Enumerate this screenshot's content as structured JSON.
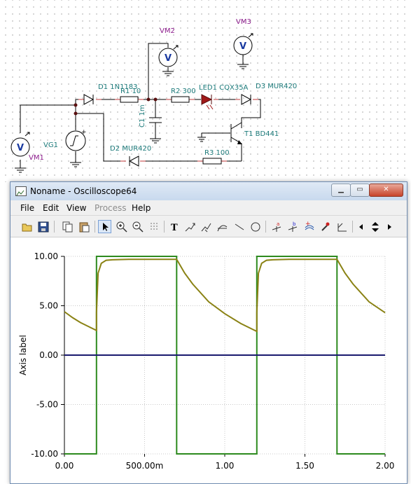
{
  "schematic": {
    "labels": {
      "vm1": "VM1",
      "vm2": "VM2",
      "vm3": "VM3",
      "vg1": "VG1",
      "d1": "D1 1N1183",
      "r1": "R1 10",
      "r2": "R2 300",
      "led1": "LED1 CQX35A",
      "d3": "D3 MUR420",
      "c1": "C1 1m",
      "t1": "T1 BD441",
      "d2": "D2 MUR420",
      "r3": "R3 100"
    },
    "meter_symbol": "V",
    "colors": {
      "meter_label": "#8b1a8b",
      "component_label": "#1c7a7a",
      "wire": "#000000"
    }
  },
  "window": {
    "title": "Noname - Oscilloscope64",
    "controls": {
      "minimize": "▁",
      "maximize": "▭",
      "close": "✕"
    },
    "menu": [
      {
        "label": "File",
        "enabled": true
      },
      {
        "label": "Edit",
        "enabled": true
      },
      {
        "label": "View",
        "enabled": true
      },
      {
        "label": "Process",
        "enabled": false
      },
      {
        "label": "Help",
        "enabled": true
      }
    ],
    "toolbar": {
      "icons": [
        "open-icon",
        "save-icon",
        "copy-icon",
        "paste-icon",
        "select-arrow-icon",
        "zoom-in-icon",
        "zoom-out-icon",
        "grid-icon",
        "text-icon",
        "cursor-tool-1-icon",
        "cursor-tool-2-icon",
        "curve-tool-icon",
        "line-tool-icon",
        "circle-tool-icon",
        "cursor-a-icon",
        "cursor-b-icon",
        "add-curve-icon",
        "eyedropper-icon",
        "step-icon",
        "scroll-left-icon",
        "scroll-updown-icon",
        "scroll-right-icon"
      ],
      "active": "select-arrow-icon"
    }
  },
  "chart_data": {
    "type": "line",
    "title": "",
    "xlabel": "",
    "ylabel": "Axis label",
    "xlim": [
      0,
      2
    ],
    "ylim": [
      -10,
      10
    ],
    "x_ticks": [
      {
        "value": 0,
        "label": "0.00"
      },
      {
        "value": 0.5,
        "label": "500.00m"
      },
      {
        "value": 1,
        "label": "1.00"
      },
      {
        "value": 1.5,
        "label": "1.50"
      },
      {
        "value": 2,
        "label": "2.00"
      }
    ],
    "y_ticks": [
      {
        "value": 10,
        "label": "10.00"
      },
      {
        "value": 5,
        "label": "5.00"
      },
      {
        "value": 0,
        "label": "0.00"
      },
      {
        "value": -5,
        "label": "-5.00"
      },
      {
        "value": -10,
        "label": "-10.00"
      }
    ],
    "grid": true,
    "series": [
      {
        "color": "#2d8a1e",
        "x": [
          0,
          0.2,
          0.2,
          0.7,
          0.7,
          1.2,
          1.2,
          1.7,
          1.7,
          2.0
        ],
        "y": [
          -10,
          -10,
          10,
          10,
          -10,
          -10,
          10,
          10,
          -10,
          -10
        ]
      },
      {
        "color": "#8a8214",
        "x": [
          0,
          0.05,
          0.1,
          0.15,
          0.2,
          0.2,
          0.21,
          0.23,
          0.26,
          0.3,
          0.4,
          0.5,
          0.6,
          0.7,
          0.75,
          0.8,
          0.9,
          1.0,
          1.1,
          1.2,
          1.2,
          1.21,
          1.23,
          1.26,
          1.3,
          1.4,
          1.5,
          1.6,
          1.7,
          1.75,
          1.8,
          1.9,
          2.0
        ],
        "y": [
          4.4,
          3.8,
          3.3,
          2.9,
          2.5,
          4.3,
          8.3,
          9.3,
          9.6,
          9.65,
          9.7,
          9.7,
          9.7,
          9.7,
          8.3,
          7.2,
          5.4,
          4.2,
          3.2,
          2.4,
          4.3,
          8.3,
          9.3,
          9.6,
          9.65,
          9.7,
          9.7,
          9.7,
          9.7,
          8.3,
          7.2,
          5.4,
          4.3
        ]
      },
      {
        "color": "#1a1a6e",
        "x": [
          0,
          2
        ],
        "y": [
          0,
          0
        ]
      }
    ]
  }
}
